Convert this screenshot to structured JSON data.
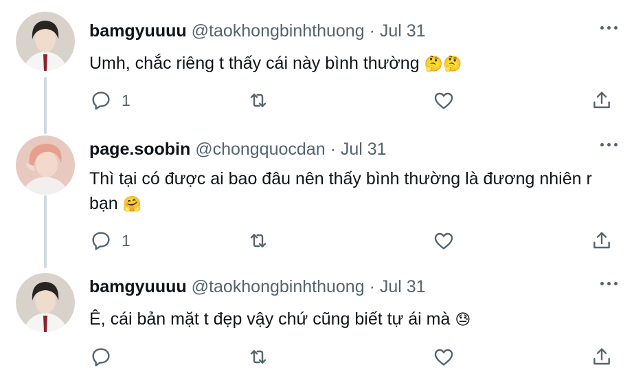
{
  "tweets": [
    {
      "name": "bamgyuuuu",
      "handle": "@taokhongbinhthuong",
      "separator": "·",
      "date": "Jul 31",
      "text_line1": "Umh, chắc riêng t thấy cái này bình thường",
      "text_emoji1": "🤔🤔",
      "text_line2": "",
      "text_emoji2": "",
      "reply_count": "1",
      "avatar_colors": {
        "bg": "#d8d2cb",
        "hair": "#2a2420",
        "face": "#f0dccd",
        "shirt": "#f5f5f3",
        "tie": "#8a2432"
      }
    },
    {
      "name": "page.soobin",
      "handle": "@chongquocdan",
      "separator": "·",
      "date": "Jul 31",
      "text_line1": "Thì tại có được ai bao đâu nên thấy bình thường là đương nhiên r",
      "text_emoji1": "",
      "text_line2": "bạn",
      "text_emoji2": "🤗",
      "reply_count": "1",
      "avatar_colors": {
        "bg": "#e7c9c0",
        "hair": "#e6a08d",
        "face": "#f3d9cc",
        "shirt": "#f2efee",
        "tie": ""
      }
    },
    {
      "name": "bamgyuuuu",
      "handle": "@taokhongbinhthuong",
      "separator": "·",
      "date": "Jul 31",
      "text_line1": "Ê, cái bản mặt t đẹp vậy chứ cũng biết tự ái mà",
      "text_emoji1": "😓",
      "text_line2": "",
      "text_emoji2": "",
      "reply_count": "",
      "avatar_colors": {
        "bg": "#d8d2cb",
        "hair": "#2a2420",
        "face": "#f0dccd",
        "shirt": "#f5f5f3",
        "tie": "#8a2432"
      }
    }
  ],
  "icons": {
    "reply": "reply-icon",
    "retweet": "retweet-icon",
    "like": "heart-icon",
    "share": "share-icon",
    "more": "more-icon"
  },
  "colors": {
    "text": "#0f1419",
    "secondary": "#536471",
    "thread_line": "#cfd9de"
  }
}
